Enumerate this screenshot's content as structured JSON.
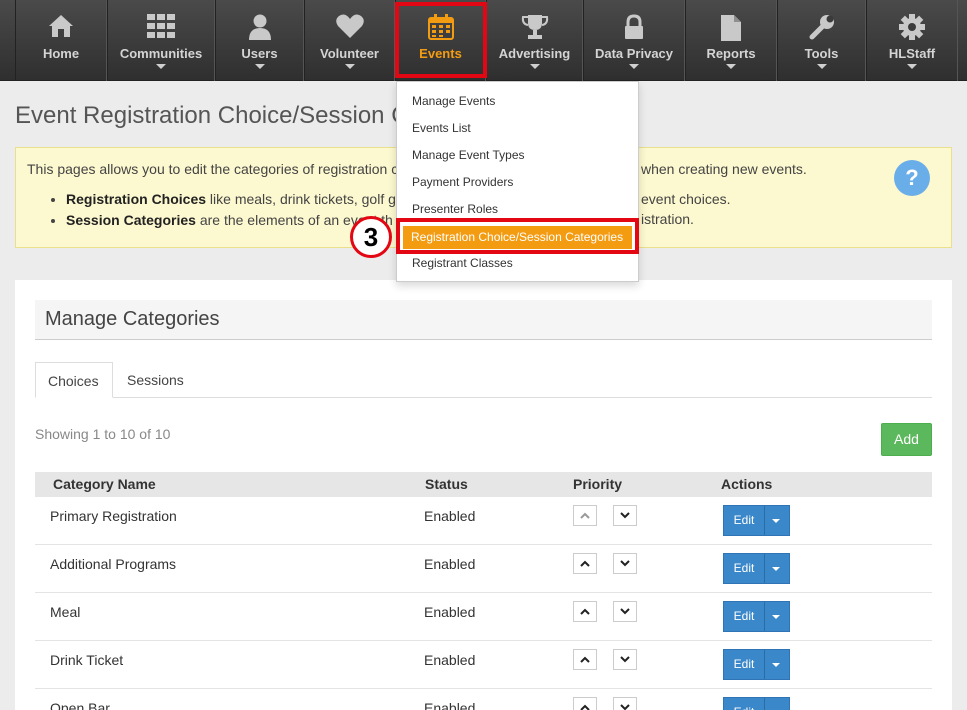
{
  "nav": {
    "items": [
      {
        "label": "Home",
        "icon": "home-icon",
        "caret": false
      },
      {
        "label": "Communities",
        "icon": "grid-icon",
        "caret": true
      },
      {
        "label": "Users",
        "icon": "user-icon",
        "caret": true
      },
      {
        "label": "Volunteer",
        "icon": "heart-icon",
        "caret": true
      },
      {
        "label": "Events",
        "icon": "calendar-icon",
        "caret": false
      },
      {
        "label": "Advertising",
        "icon": "trophy-icon",
        "caret": true
      },
      {
        "label": "Data Privacy",
        "icon": "lock-icon",
        "caret": true
      },
      {
        "label": "Reports",
        "icon": "document-icon",
        "caret": true
      },
      {
        "label": "Tools",
        "icon": "wrench-icon",
        "caret": true
      },
      {
        "label": "HLStaff",
        "icon": "gear-icon",
        "caret": true
      }
    ],
    "active_color": "#f39c12"
  },
  "events_menu": {
    "items": [
      "Manage Events",
      "Events List",
      "Manage Event Types",
      "Payment Providers",
      "Presenter Roles",
      "Registration Choice/Session Categories",
      "Registrant Classes"
    ],
    "selected_index": 5
  },
  "step_badge": "3",
  "page": {
    "title": "Event Registration Choice/Session Ca"
  },
  "info": {
    "intro": "This pages allows you to edit the categories of registration c",
    "intro_end": "when creating new events.",
    "bullet1_bold": "Registration Choices",
    "bullet1_text": " like meals, drink tickets, golf g",
    "bullet1_end": "event choices.",
    "bullet2_bold": "Session Categories",
    "bullet2_text": " are the elements of an event th",
    "bullet2_end": "istration.",
    "help_symbol": "?"
  },
  "panel": {
    "title": "Manage Categories",
    "tabs": [
      "Choices",
      "Sessions"
    ],
    "showing": "Showing 1 to 10 of 10",
    "add_label": "Add"
  },
  "table": {
    "headers": [
      "Category Name",
      "Status",
      "Priority",
      "Actions"
    ],
    "rows": [
      {
        "name": "Primary Registration",
        "status": "Enabled"
      },
      {
        "name": "Additional Programs",
        "status": "Enabled"
      },
      {
        "name": "Meal",
        "status": "Enabled"
      },
      {
        "name": "Drink Ticket",
        "status": "Enabled"
      },
      {
        "name": "Open Bar",
        "status": "Enabled"
      }
    ],
    "edit_label": "Edit"
  },
  "colors": {
    "accent": "#f39c12",
    "highlight": "#e30613",
    "primary": "#3a87ca",
    "success": "#5cb85c",
    "info_bg": "#fcf8cf"
  }
}
